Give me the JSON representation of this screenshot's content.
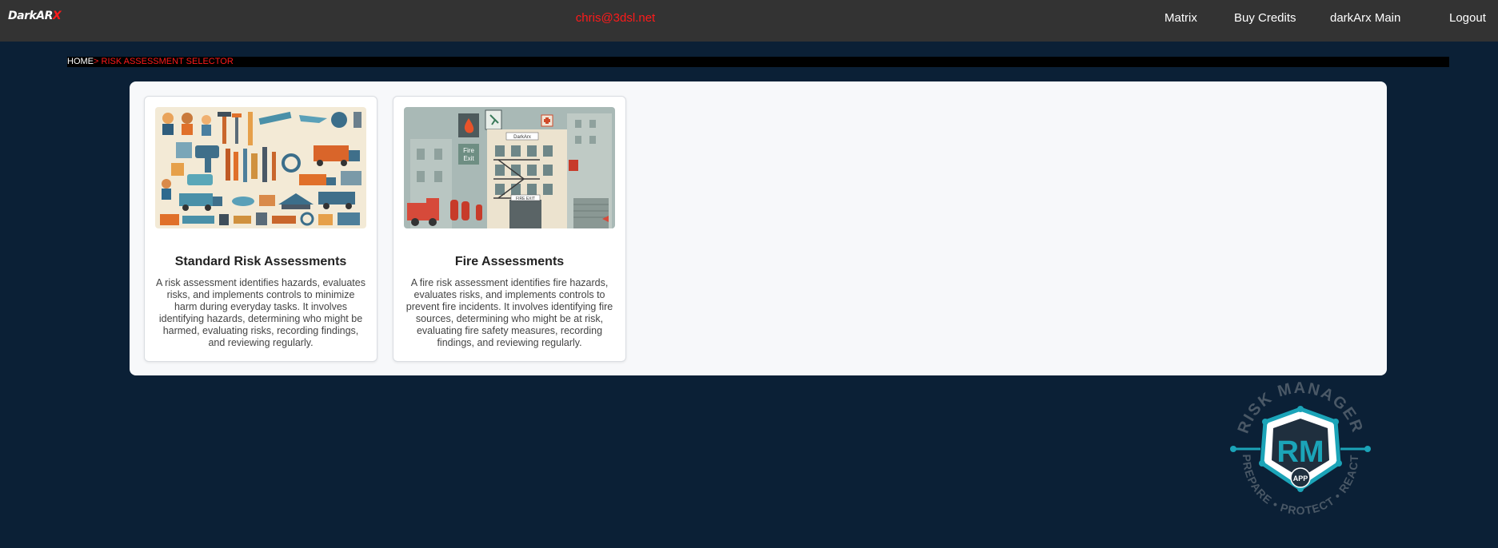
{
  "header": {
    "logo_text": "DarkAR",
    "logo_accent": "X",
    "user_email": "chris@3dsl.net",
    "nav": {
      "matrix": "Matrix",
      "buy_credits": "Buy Credits",
      "darkarx_main": "darkArx Main",
      "logout": "Logout"
    }
  },
  "breadcrumb": {
    "home": "HOME",
    "separator": ">",
    "current": "RISK ASSESSMENT SELECTOR"
  },
  "cards": [
    {
      "title": "Standard Risk Assessments",
      "description": "A risk assessment identifies hazards, evaluates risks, and implements controls to minimize harm during everyday tasks. It involves identifying hazards, determining who might be harmed, evaluating risks, recording findings, and reviewing regularly."
    },
    {
      "title": "Fire Assessments",
      "description": "A fire risk assessment identifies fire hazards, evaluates risks, and implements controls to prevent fire incidents. It involves identifying fire sources, determining who might be at risk, evaluating fire safety measures, recording findings, and reviewing regularly.",
      "image_text": {
        "fire_exit_sign_line1": "Fire",
        "fire_exit_sign_line2": "Exit",
        "building_sign": "DarkArx",
        "door_sign": "FIRE EXIT"
      }
    }
  ],
  "brand_logo": {
    "top_text": "RISK MANAGER",
    "bottom_text": "PREPARE • PROTECT • REACT",
    "badge": "APP",
    "monogram": "RM"
  },
  "colors": {
    "page_background": "#0b2036",
    "topbar": "#333333",
    "accent_red": "#ff1a1a",
    "panel": "#f7f8fa",
    "logo_teal": "#1ba4b8",
    "logo_gray": "#4a5866"
  }
}
